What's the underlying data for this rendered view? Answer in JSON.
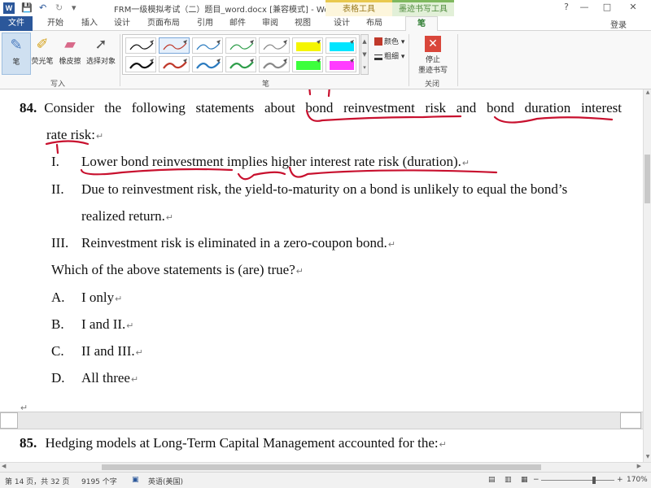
{
  "titlebar": {
    "title": "FRM一级模拟考试（二）题目_word.docx [兼容模式] - Word",
    "word_icon": "W",
    "context_tab_table": "表格工具",
    "context_tab_ink": "墨迹书写工具",
    "help": "?",
    "minimize": "—",
    "restore": "□",
    "close": "✕",
    "qat_save": "💾",
    "qat_undo": "↶",
    "qat_redo": "↻",
    "qat_more": "▾"
  },
  "tabs": {
    "file": "文件",
    "home": "开始",
    "insert": "插入",
    "design": "设计",
    "layout": "页面布局",
    "references": "引用",
    "mailings": "邮件",
    "review": "审阅",
    "view": "视图",
    "table_design": "设计",
    "table_layout": "布局",
    "pen": "笔",
    "login": "登录"
  },
  "ribbon": {
    "write_group": {
      "label": "写入",
      "pen": "笔",
      "highlighter": "荧光笔",
      "eraser": "橡皮擦",
      "select": "选择对象"
    },
    "pens_group": {
      "label": "笔",
      "color_option": "颜色",
      "weight_option": "粗细",
      "pens": [
        {
          "color": "#111111",
          "selected": false
        },
        {
          "color": "#c0392b",
          "selected": true
        },
        {
          "color": "#2b7bbf",
          "selected": false
        },
        {
          "color": "#2e9e4a",
          "selected": false
        },
        {
          "color": "#888888",
          "selected": false
        },
        {
          "color": "#f5f500",
          "selected": false
        },
        {
          "color": "#00e5ff",
          "selected": false
        },
        {
          "color": "#111111",
          "selected": false
        },
        {
          "color": "#c0392b",
          "selected": false
        },
        {
          "color": "#2b7bbf",
          "selected": false
        },
        {
          "color": "#2e9e4a",
          "selected": false
        },
        {
          "color": "#888888",
          "selected": false
        },
        {
          "color": "#3cff3c",
          "selected": false
        },
        {
          "color": "#ff3cff",
          "selected": false
        }
      ]
    },
    "close_group": {
      "label": "关闭",
      "stop_line1": "停止",
      "stop_line2": "墨迹书写"
    }
  },
  "document": {
    "q84_number": "84.",
    "q84_line1": "Consider the following statements about bond reinvestment risk and bond duration interest",
    "q84_line2": "rate risk:",
    "items": [
      {
        "num": "I.",
        "text": "Lower bond reinvestment implies higher interest rate risk (duration)."
      },
      {
        "num": "II.",
        "text": "Due to reinvestment risk, the yield-to-maturity on a bond is unlikely to equal the bond’s"
      },
      {
        "num": "",
        "text": "realized return."
      },
      {
        "num": "III.",
        "text": "Reinvestment risk is eliminated in a zero-coupon bond."
      }
    ],
    "question": "Which of the above statements is (are) true?",
    "options": [
      {
        "letter": "A.",
        "text": "I only"
      },
      {
        "letter": "B.",
        "text": "I and II."
      },
      {
        "letter": "C.",
        "text": "II and III."
      },
      {
        "letter": "D.",
        "text": "All three"
      }
    ],
    "paragraph_mark": "↵",
    "q85_number": "85.",
    "q85_text": "Hedging models at Long-Term Capital Management accounted for the:",
    "ink_color": "#c8102e"
  },
  "statusbar": {
    "page": "第 14 页，共 32 页",
    "words": "9195 个字",
    "language": "英语(美国)",
    "zoom_minus": "−",
    "zoom_plus": "+",
    "zoom": "170%"
  }
}
